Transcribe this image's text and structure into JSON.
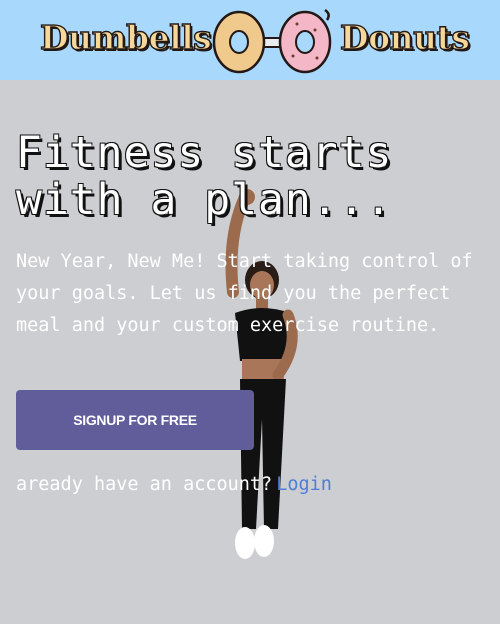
{
  "header": {
    "brand_left": "Dumbells",
    "brand_right": "Donuts",
    "logo_icon": "dumbbell-donut-logo-icon"
  },
  "hero": {
    "headline_line1": "Fitness starts",
    "headline_line2": "with a plan...",
    "intro": "New Year, New Me! Start taking control of your goals. Let us find you the perfect meal and your custom exercise routine.",
    "figure_icon": "exercising-woman-illustration-icon"
  },
  "cta": {
    "signup_label": "SIGNUP FOR FREE",
    "account_prompt": "aready have an account?",
    "login_label": "Login"
  },
  "colors": {
    "header_bg": "#a8d8fb",
    "page_bg": "#ccced1",
    "button_bg": "#615d9b",
    "link": "#4b7fd6"
  }
}
